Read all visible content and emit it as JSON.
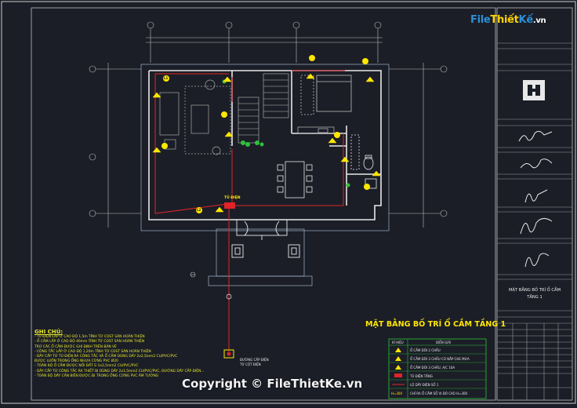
{
  "watermark": {
    "brand_prefix": "File",
    "brand_mid": "Thiết",
    "brand_suffix": "Kế",
    "brand_domain": ".vn",
    "copyright": "Copyright © FileThietKe.vn"
  },
  "plan": {
    "title": "MẶT BẰNG BỐ TRÍ Ổ CẮM TẦNG 1",
    "panel_tag": "TỦ ĐIỆN",
    "feed_label_1": "ĐƯỜNG CẤP ĐIỆN",
    "feed_label_2": "TỪ CỘT ĐIỆN",
    "outlet_tag": "L1",
    "outlet_tag_2": "L2"
  },
  "notes": {
    "heading": "GHI CHÚ:",
    "lines": [
      "- TỦ ĐIỆN LẮP Ở CAO ĐỘ 1,5m TÍNH TỪ COST SÀN HOÀN THIỆN",
      "- Ổ CẮM LẮP Ở CAO ĐỘ 40mm TÍNH TỪ COST SÀN HOÀN THIỆN",
      "  TRỪ CÁC Ổ CẮM ĐƯỢC GHI ĐỊNH TRÊN BẢN VẼ",
      "- CÔNG TẮC LẮP Ở CAO ĐỘ 1,20m TÍNH TỪ COST SÀN HOÀN THIỆN",
      "- DÂY CẤP TỪ TỦ ĐIỆN RA CÔNG TẮC VÀ Ổ CẮM DÙNG DÂY 2x2,5mm2 CU/PVC/PVC",
      "  ĐƯỢC LUỒN TRONG ỐNG NHỰA CỨNG PVC Ø20",
      "- TOÀN BỘ Ổ CẮM ĐƯỢC NỐI ĐẤT E-1x2,5mm2 CU/PVC/PVC",
      "- DÂY CẤP TỪ CÔNG TẮC RA THIẾT BỊ DÙNG DÂY 2x1,5mm2 CU/PVC/PVC, ĐƯỜNG DÂY CẤP ĐIỆN...",
      "- TOÀN BỘ DÂY CẦN BIÊN ĐƯỢC ĐI TRONG ỐNG CỨNG PVC ÂM TƯỜNG"
    ]
  },
  "legend": {
    "header_symbol": "KÍ HIỆU",
    "header_desc": "DIỄN GIẢI",
    "rows": [
      "Ổ CẮM ĐÔI 2 CHẤU",
      "Ổ CẮM ĐÔI 3 CHẤU CÓ NẮP CHE MƯA",
      "Ổ CẮM ĐÔI 3 CHẤU, A/C 16A",
      "TỦ ĐIỆN TẦNG",
      "LỘ DÂY ĐIỆN SỐ 1",
      "CHỈ RA Ổ CẮM SỐ VỊ ĐÓ CAO H=300"
    ],
    "last_symbol": "H=300"
  },
  "title_block": {
    "drawing_name_1": "MẶT BẰNG BỐ TRÍ Ổ CẮM",
    "drawing_name_2": "TẦNG 1"
  },
  "colors": {
    "background": "#1b1e27",
    "wall": "#e8e8e8",
    "wire": "#e0242a",
    "notes": "#e6e62a",
    "furniture": "#a8a8a8",
    "accent_green": "#2ec23a",
    "yellow": "#ffe600"
  }
}
